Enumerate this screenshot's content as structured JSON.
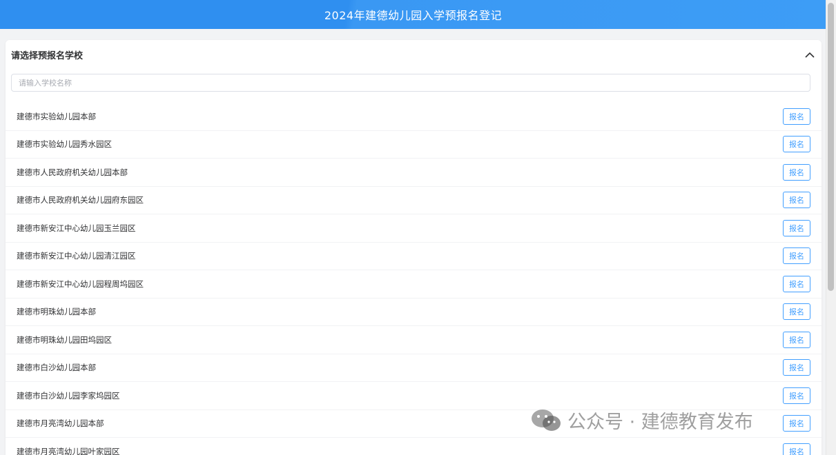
{
  "header": {
    "title": "2024年建德幼儿园入学预报名登记"
  },
  "panel": {
    "title": "请选择预报名学校",
    "collapse_icon": "chevron-up-icon"
  },
  "search": {
    "placeholder": "请输入学校名称",
    "value": ""
  },
  "schools": [
    {
      "name": "建德市实验幼儿园本部",
      "button": "报名"
    },
    {
      "name": "建德市实验幼儿园秀水园区",
      "button": "报名"
    },
    {
      "name": "建德市人民政府机关幼儿园本部",
      "button": "报名"
    },
    {
      "name": "建德市人民政府机关幼儿园府东园区",
      "button": "报名"
    },
    {
      "name": "建德市新安江中心幼儿园玉兰园区",
      "button": "报名"
    },
    {
      "name": "建德市新安江中心幼儿园清江园区",
      "button": "报名"
    },
    {
      "name": "建德市新安江中心幼儿园程周坞园区",
      "button": "报名"
    },
    {
      "name": "建德市明珠幼儿园本部",
      "button": "报名"
    },
    {
      "name": "建德市明珠幼儿园田坞园区",
      "button": "报名"
    },
    {
      "name": "建德市白沙幼儿园本部",
      "button": "报名"
    },
    {
      "name": "建德市白沙幼儿园李家坞园区",
      "button": "报名"
    },
    {
      "name": "建德市月亮湾幼儿园本部",
      "button": "报名"
    },
    {
      "name": "建德市月亮湾幼儿园叶家园区",
      "button": "报名"
    }
  ],
  "watermark": {
    "text": "公众号 · 建德教育发布",
    "icon": "wechat-logo-icon"
  },
  "colors": {
    "header_bg": "#2f8ff0",
    "accent": "#409eff",
    "page_bg": "#f2f3f5"
  }
}
